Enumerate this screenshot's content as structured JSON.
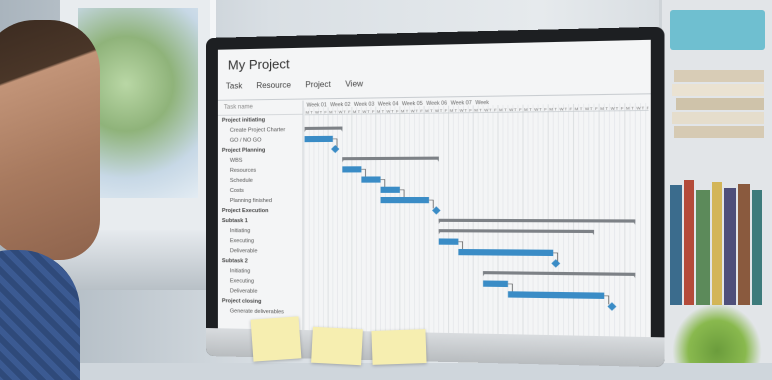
{
  "app": {
    "title": "My Project",
    "menu": [
      "Task",
      "Resource",
      "Project",
      "View"
    ]
  },
  "task_header": "Task name",
  "tasks": [
    {
      "label": "Project initiating",
      "bold": true
    },
    {
      "label": "Create Project Charter",
      "bold": false
    },
    {
      "label": "GO / NO GO",
      "bold": false
    },
    {
      "label": "Project Planning",
      "bold": true
    },
    {
      "label": "WBS",
      "bold": false
    },
    {
      "label": "Resources",
      "bold": false
    },
    {
      "label": "Schedule",
      "bold": false
    },
    {
      "label": "Costs",
      "bold": false
    },
    {
      "label": "Planning finished",
      "bold": false
    },
    {
      "label": "Project Execution",
      "bold": true
    },
    {
      "label": "Subtask 1",
      "bold": true
    },
    {
      "label": "Initiating",
      "bold": false
    },
    {
      "label": "Executing",
      "bold": false
    },
    {
      "label": "Deliverable",
      "bold": false
    },
    {
      "label": "Subtask 2",
      "bold": true
    },
    {
      "label": "Initiating",
      "bold": false
    },
    {
      "label": "Executing",
      "bold": false
    },
    {
      "label": "Deliverable",
      "bold": false
    },
    {
      "label": "Project closing",
      "bold": true
    },
    {
      "label": "Generate deliverables",
      "bold": false
    }
  ],
  "weeks": [
    "Week 01",
    "Week 02",
    "Week 03",
    "Week 04",
    "Week 05",
    "Week 06",
    "Week 07",
    "Week"
  ],
  "day_letters": [
    "M",
    "T",
    "W",
    "T",
    "F"
  ],
  "colors": {
    "bar": "#3a8cc6",
    "summary": "#7d8186",
    "grid": "#d9dcdf"
  },
  "gantt": [
    {
      "row": 0,
      "type": "summary",
      "start": 0,
      "end": 7
    },
    {
      "row": 1,
      "type": "task",
      "start": 0,
      "end": 5
    },
    {
      "row": 2,
      "type": "milestone",
      "start": 6
    },
    {
      "row": 3,
      "type": "summary",
      "start": 8,
      "end": 27
    },
    {
      "row": 4,
      "type": "task",
      "start": 8,
      "end": 11
    },
    {
      "row": 5,
      "type": "task",
      "start": 12,
      "end": 15
    },
    {
      "row": 6,
      "type": "task",
      "start": 16,
      "end": 19
    },
    {
      "row": 7,
      "type": "task",
      "start": 16,
      "end": 25
    },
    {
      "row": 8,
      "type": "milestone",
      "start": 27
    },
    {
      "row": 9,
      "type": "summary",
      "start": 28,
      "end": 66
    },
    {
      "row": 10,
      "type": "summary",
      "start": 28,
      "end": 58
    },
    {
      "row": 11,
      "type": "task",
      "start": 28,
      "end": 31
    },
    {
      "row": 12,
      "type": "task",
      "start": 32,
      "end": 50
    },
    {
      "row": 13,
      "type": "milestone",
      "start": 51
    },
    {
      "row": 14,
      "type": "summary",
      "start": 37,
      "end": 66
    },
    {
      "row": 15,
      "type": "task",
      "start": 37,
      "end": 41
    },
    {
      "row": 16,
      "type": "task",
      "start": 42,
      "end": 60
    },
    {
      "row": 17,
      "type": "milestone",
      "start": 62
    }
  ],
  "sticky_notes": [
    "",
    "",
    ""
  ]
}
